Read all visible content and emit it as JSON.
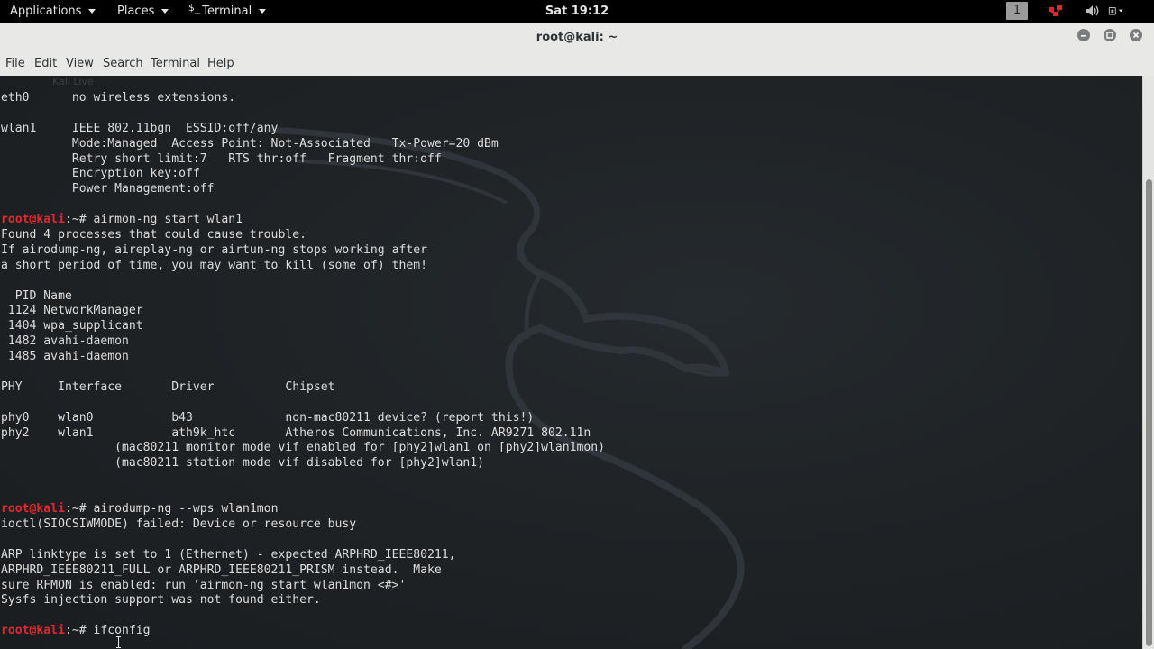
{
  "panel": {
    "applications": "Applications",
    "places": "Places",
    "terminal_glyph": "$_",
    "terminal": "Terminal",
    "clock": "Sat 19:12",
    "workspace": "1"
  },
  "window": {
    "title": "root@kali: ~"
  },
  "menubar": {
    "file": "File",
    "edit": "Edit",
    "view": "View",
    "search": "Search",
    "terminal": "Terminal",
    "help": "Help"
  },
  "terminal": {
    "ghost_text": "Kali Live",
    "prompt_user": "root@kali",
    "lines": [
      {
        "text": "eth0      no wireless extensions."
      },
      {
        "text": ""
      },
      {
        "text": "wlan1     IEEE 802.11bgn  ESSID:off/any"
      },
      {
        "text": "          Mode:Managed  Access Point: Not-Associated   Tx-Power=20 dBm"
      },
      {
        "text": "          Retry short limit:7   RTS thr:off   Fragment thr:off"
      },
      {
        "text": "          Encryption key:off"
      },
      {
        "text": "          Power Management:off"
      },
      {
        "text": ""
      },
      {
        "prompt": "root@kali",
        "text": ":~# airmon-ng start wlan1"
      },
      {
        "text": "Found 4 processes that could cause trouble."
      },
      {
        "text": "If airodump-ng, aireplay-ng or airtun-ng stops working after"
      },
      {
        "text": "a short period of time, you may want to kill (some of) them!"
      },
      {
        "text": ""
      },
      {
        "text": "  PID Name"
      },
      {
        "text": " 1124 NetworkManager"
      },
      {
        "text": " 1404 wpa_supplicant"
      },
      {
        "text": " 1482 avahi-daemon"
      },
      {
        "text": " 1485 avahi-daemon"
      },
      {
        "text": ""
      },
      {
        "text": "PHY     Interface       Driver          Chipset"
      },
      {
        "text": ""
      },
      {
        "text": "phy0    wlan0           b43             non-mac80211 device? (report this!)"
      },
      {
        "text": "phy2    wlan1           ath9k_htc       Atheros Communications, Inc. AR9271 802.11n"
      },
      {
        "text": "                (mac80211 monitor mode vif enabled for [phy2]wlan1 on [phy2]wlan1mon)"
      },
      {
        "text": "                (mac80211 station mode vif disabled for [phy2]wlan1)"
      },
      {
        "text": ""
      },
      {
        "text": ""
      },
      {
        "prompt": "root@kali",
        "text": ":~# airodump-ng --wps wlan1mon"
      },
      {
        "text": "ioctl(SIOCSIWMODE) failed: Device or resource busy"
      },
      {
        "text": ""
      },
      {
        "text": "ARP linktype is set to 1 (Ethernet) - expected ARPHRD_IEEE80211,"
      },
      {
        "text": "ARPHRD_IEEE80211_FULL or ARPHRD_IEEE80211_PRISM instead.  Make"
      },
      {
        "text": "sure RFMON is enabled: run 'airmon-ng start wlan1mon <#>'"
      },
      {
        "text": "Sysfs injection support was not found either."
      },
      {
        "text": ""
      },
      {
        "prompt": "root@kali",
        "text": ":~# ifconfig"
      }
    ]
  },
  "colors": {
    "panel_bg": "#000000",
    "terminal_bg": "#1f2326",
    "terminal_fg": "#dcdcdc",
    "prompt_red": "#e5282f",
    "chrome_bg": "#e8e8e7"
  },
  "icons": [
    "terminal-icon",
    "workspace-indicator",
    "network-icon",
    "volume-icon",
    "power-icon",
    "minimize-icon",
    "maximize-icon",
    "close-icon",
    "kali-dragon-logo",
    "ibeam-cursor-icon"
  ]
}
